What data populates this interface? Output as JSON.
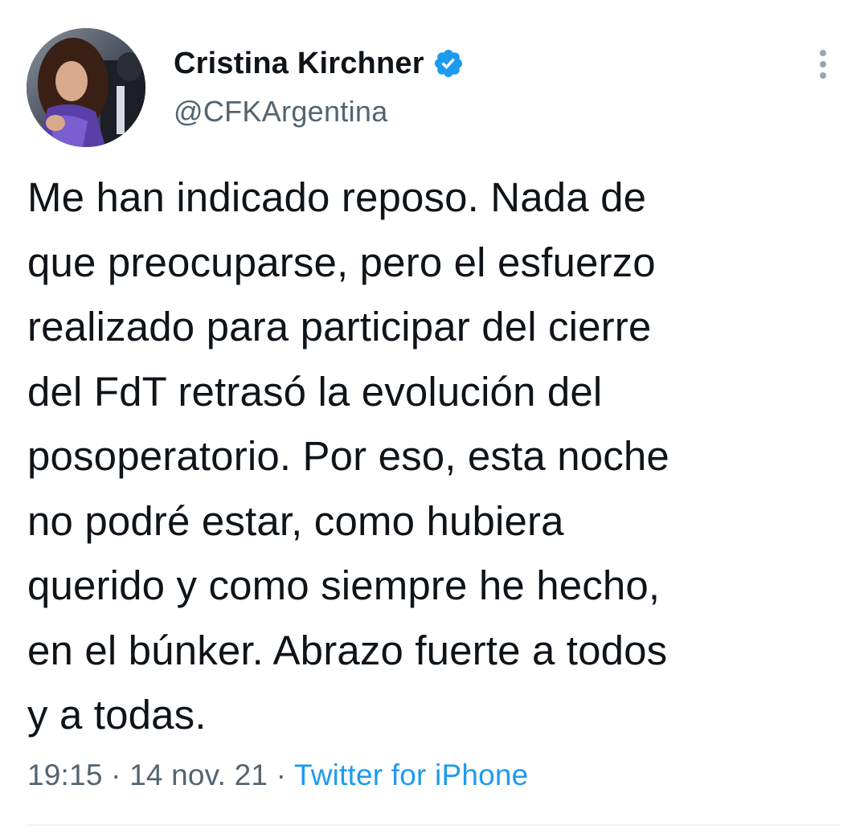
{
  "author": {
    "display_name": "Cristina Kirchner",
    "handle": "@CFKArgentina",
    "verified": true,
    "avatar_icon": "profile-photo",
    "verified_icon": "verified-badge-icon",
    "verified_color": "#1d9bf0"
  },
  "menu": {
    "icon": "more-vertical-icon"
  },
  "tweet": {
    "lines": [
      "Me han indicado reposo. Nada de",
      "que preocuparse, pero el esfuerzo",
      "realizado para participar del cierre",
      "del FdT retrasó la evolución del",
      "posoperatorio. Por eso, esta noche",
      "no podré estar, como hubiera",
      "querido y como siempre he hecho,",
      "en el búnker. Abrazo fuerte a todos",
      "y a todas."
    ]
  },
  "meta": {
    "time": "19:15",
    "separator": " · ",
    "date": "14 nov. 21",
    "source": "Twitter for iPhone"
  },
  "colors": {
    "text": "#0f1419",
    "secondary": "#536471",
    "link": "#1d9bf0",
    "divider": "#eff3f4"
  }
}
